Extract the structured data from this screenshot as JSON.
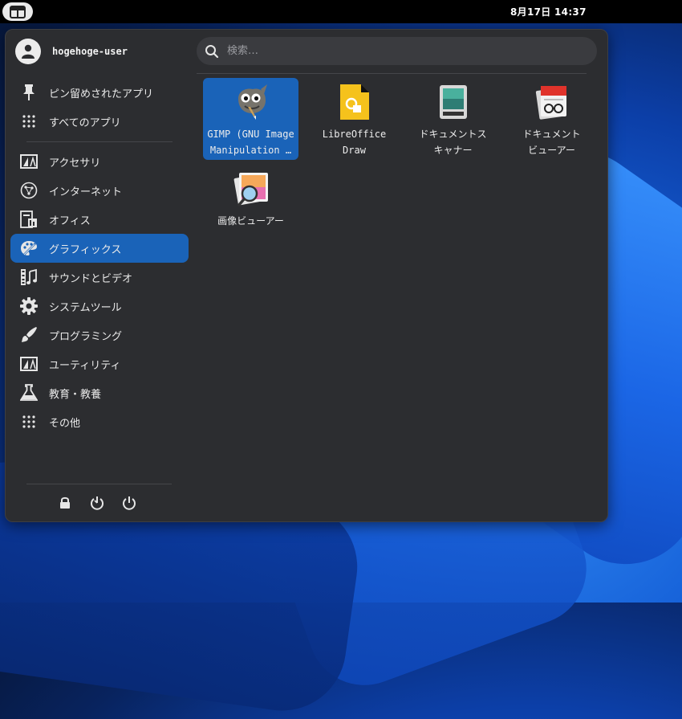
{
  "topbar": {
    "clock": "8月17日  14:37",
    "launcher_icon": "app-grid-icon"
  },
  "user": {
    "name": "hogehoge-user",
    "avatar_icon": "user-avatar-icon"
  },
  "search": {
    "placeholder": "検索…",
    "value": ""
  },
  "sidebar": {
    "top_items": [
      {
        "label": "ピン留めされたアプリ",
        "icon": "pin-icon"
      },
      {
        "label": "すべてのアプリ",
        "icon": "grid-dots-icon"
      }
    ],
    "categories": [
      {
        "label": "アクセサリ",
        "icon": "accessories-icon"
      },
      {
        "label": "インターネット",
        "icon": "globe-icon"
      },
      {
        "label": "オフィス",
        "icon": "office-icon"
      },
      {
        "label": "グラフィックス",
        "icon": "palette-icon",
        "active": true
      },
      {
        "label": "サウンドとビデオ",
        "icon": "film-music-icon"
      },
      {
        "label": "システムツール",
        "icon": "gear-icon"
      },
      {
        "label": "プログラミング",
        "icon": "brush-icon"
      },
      {
        "label": "ユーティリティ",
        "icon": "utilities-icon"
      },
      {
        "label": "教育・教養",
        "icon": "flask-icon"
      },
      {
        "label": "その他",
        "icon": "grid-dots-icon"
      }
    ]
  },
  "bottom_actions": [
    {
      "name": "lock",
      "icon": "lock-icon"
    },
    {
      "name": "logout",
      "icon": "logout-icon"
    },
    {
      "name": "power",
      "icon": "power-icon"
    }
  ],
  "apps": [
    {
      "label": "GIMP (GNU Image\nManipulation …",
      "icon": "gimp-icon",
      "selected": true
    },
    {
      "label": "LibreOffice\nDraw",
      "icon": "libreoffice-draw-icon"
    },
    {
      "label": "ドキュメントス\nキャナー",
      "icon": "document-scanner-icon"
    },
    {
      "label": "ドキュメント\nビューアー",
      "icon": "document-viewer-icon"
    },
    {
      "label": "画像ビューアー",
      "icon": "image-viewer-icon"
    }
  ],
  "colors": {
    "accent": "#1a63b8",
    "panel_bg": "#2c2d30",
    "topbar_bg": "#000000"
  }
}
